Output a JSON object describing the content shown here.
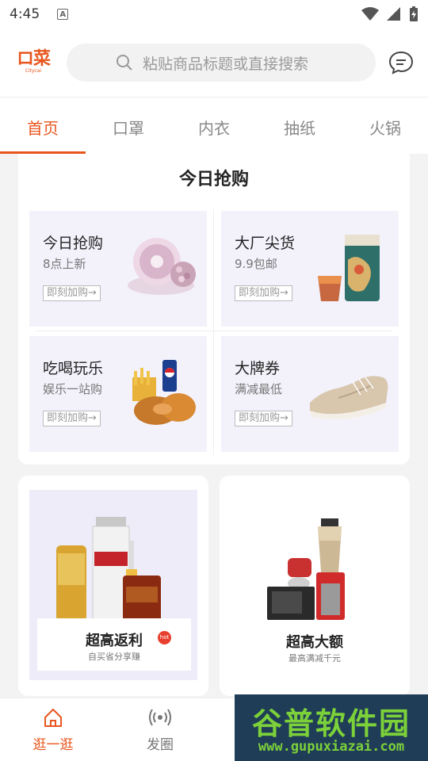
{
  "status": {
    "time": "4:45",
    "indicator": "A"
  },
  "header": {
    "logo_mark": "ロ菜",
    "logo_sub": "Citycai",
    "search_placeholder": "粘贴商品标题或直接搜索",
    "icons": [
      "search-icon",
      "message-icon"
    ]
  },
  "tabs": [
    {
      "label": "首页",
      "active": true
    },
    {
      "label": "口罩",
      "active": false
    },
    {
      "label": "内衣",
      "active": false
    },
    {
      "label": "抽纸",
      "active": false
    },
    {
      "label": "火锅",
      "active": false
    }
  ],
  "today": {
    "title": "今日抢购",
    "cells": [
      {
        "title": "今日抢购",
        "sub": "8点上新",
        "button": "即刻加购→"
      },
      {
        "title": "大厂尖货",
        "sub": "9.9包邮",
        "button": "即刻加购→"
      },
      {
        "title": "吃喝玩乐",
        "sub": "娱乐一站购",
        "button": "即刻加购→"
      },
      {
        "title": "大牌券",
        "sub": "满减最低",
        "button": "即刻加购→"
      }
    ]
  },
  "promos": [
    {
      "title": "超高返利",
      "sub": "自买省分享赚",
      "badge": "hot"
    },
    {
      "title": "超高大额",
      "sub": "最高满减千元"
    }
  ],
  "bottom_nav": [
    {
      "label": "逛一逛",
      "active": true,
      "icon": "home-icon"
    },
    {
      "label": "发圈",
      "active": false,
      "icon": "broadcast-icon"
    }
  ],
  "watermark": {
    "line1": "谷普软件园",
    "line2": "www.gupuxiazai.com"
  },
  "colors": {
    "accent": "#e8561e",
    "cell_bg": "#f3f2fb",
    "badge": "#e8402e"
  }
}
